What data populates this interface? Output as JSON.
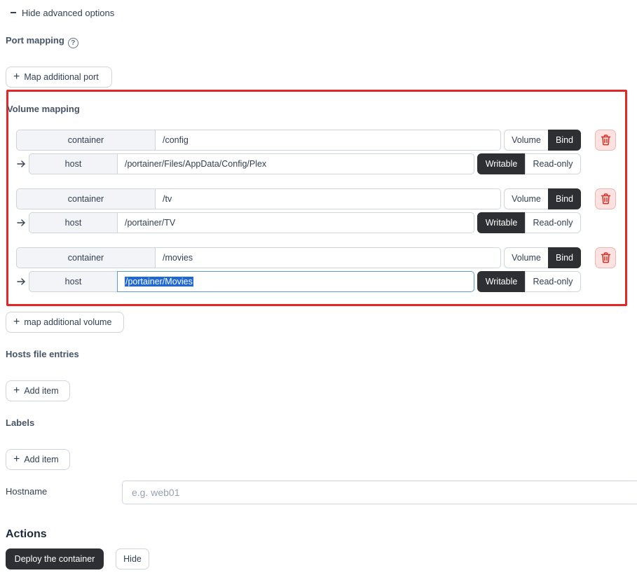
{
  "advanced_toggle": {
    "label": "Hide advanced options"
  },
  "port_mapping": {
    "title": "Port mapping",
    "help_icon": "?",
    "add_button": "Map additional port"
  },
  "volume_mapping": {
    "title": "Volume mapping",
    "rows": [
      {
        "container_label": "container",
        "container_path": "/config",
        "type_options": [
          "Volume",
          "Bind"
        ],
        "type_selected": "Bind",
        "host_label": "host",
        "host_path": "/portainer/Files/AppData/Config/Plex",
        "access_options": [
          "Writable",
          "Read-only"
        ],
        "access_selected": "Writable"
      },
      {
        "container_label": "container",
        "container_path": "/tv",
        "type_options": [
          "Volume",
          "Bind"
        ],
        "type_selected": "Bind",
        "host_label": "host",
        "host_path": "/portainer/TV",
        "access_options": [
          "Writable",
          "Read-only"
        ],
        "access_selected": "Writable"
      },
      {
        "container_label": "container",
        "container_path": "/movies",
        "type_options": [
          "Volume",
          "Bind"
        ],
        "type_selected": "Bind",
        "host_label": "host",
        "host_path": "/portainer/Movies",
        "access_options": [
          "Writable",
          "Read-only"
        ],
        "access_selected": "Writable"
      }
    ],
    "add_button": "map additional volume",
    "highlight_color": "#e32626"
  },
  "hosts_file": {
    "title": "Hosts file entries",
    "add_button": "Add item"
  },
  "labels": {
    "title": "Labels",
    "add_button": "Add item"
  },
  "hostname": {
    "label": "Hostname",
    "placeholder": "e.g. web01",
    "value": ""
  },
  "actions": {
    "title": "Actions",
    "deploy_button": "Deploy the container",
    "hide_button": "Hide"
  },
  "colors": {
    "dark_button": "#2d2f33",
    "danger_bg": "#fde2e1",
    "danger_icon": "#d92d20",
    "selection": "#1d67d6"
  },
  "icons": {
    "trash": "trash-icon",
    "arrow": "arrow-right-icon",
    "plus": "plus-icon",
    "minus": "minus-icon",
    "help": "help-circle-icon"
  }
}
